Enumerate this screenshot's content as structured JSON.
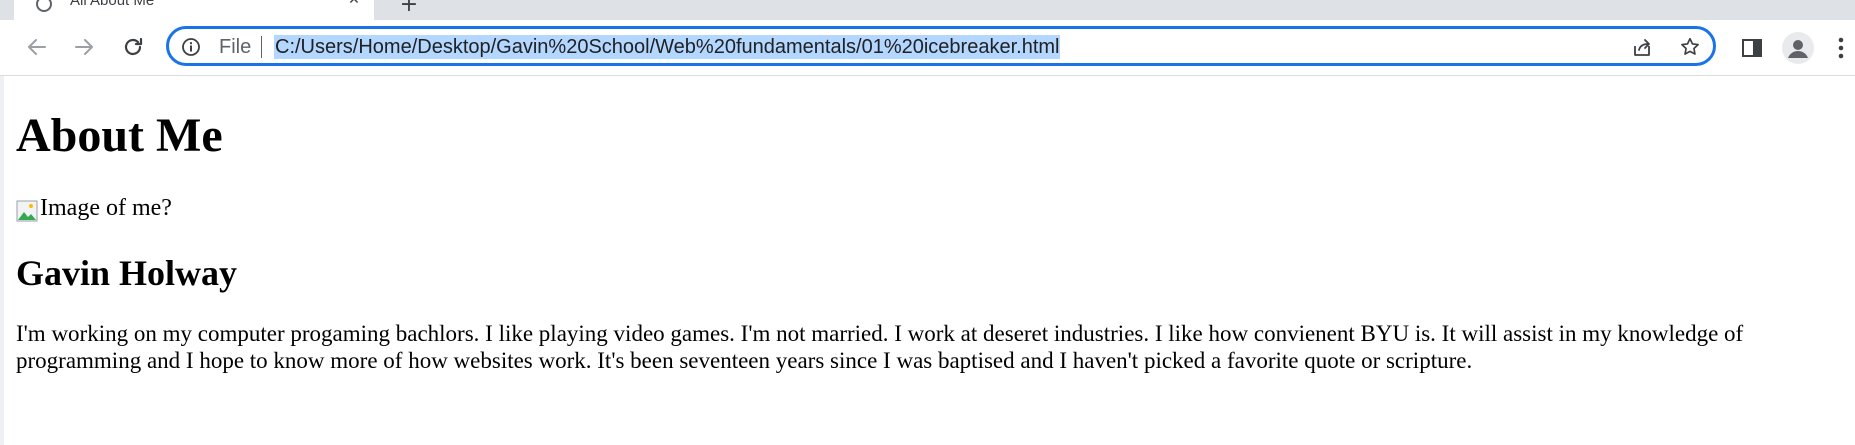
{
  "browser": {
    "tab": {
      "title": "All About Me"
    },
    "address_bar": {
      "scheme_label": "File",
      "url": "C:/Users/Home/Desktop/Gavin%20School/Web%20fundamentals/01%20icebreaker.html"
    },
    "icons": {
      "back": "back-arrow-icon",
      "forward": "forward-arrow-icon",
      "reload": "reload-icon",
      "info": "info-icon",
      "share": "share-icon",
      "bookmark": "star-icon",
      "side_panel": "side-panel-icon",
      "profile": "profile-icon",
      "menu": "more-vert-icon"
    },
    "colors": {
      "focus_ring": "#1a73e8",
      "selection": "#b4d7ff"
    }
  },
  "page": {
    "heading": "About Me",
    "image_alt": "Image of me?",
    "name": "Gavin Holway",
    "bio": "I'm working on my computer progaming bachlors. I like playing video games. I'm not married. I work at deseret industries. I like how convienent BYU is. It will assist in my knowledge of programming and I hope to know more of how websites work. It's been seventeen years since I was baptised and I haven't picked a favorite quote or scripture."
  }
}
